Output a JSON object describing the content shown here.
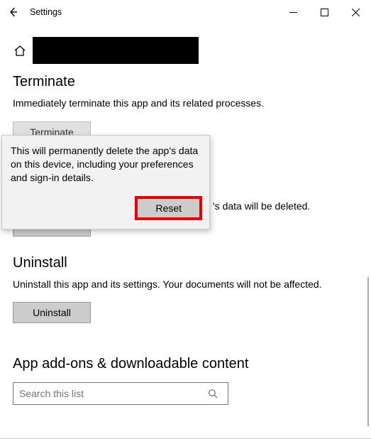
{
  "titlebar": {
    "title": "Settings"
  },
  "terminate": {
    "heading": "Terminate",
    "desc": "Immediately terminate this app and its related processes.",
    "button": "Terminate"
  },
  "reset": {
    "peek_desc": "'s data will be deleted.",
    "button": "Reset"
  },
  "flyout": {
    "text": "This will permanently delete the app's data on this device, including your preferences and sign-in details.",
    "confirm": "Reset"
  },
  "uninstall": {
    "heading": "Uninstall",
    "desc": "Uninstall this app and its settings. Your documents will not be affected.",
    "button": "Uninstall"
  },
  "addons": {
    "heading": "App add-ons & downloadable content"
  },
  "search": {
    "placeholder": "Search this list"
  }
}
